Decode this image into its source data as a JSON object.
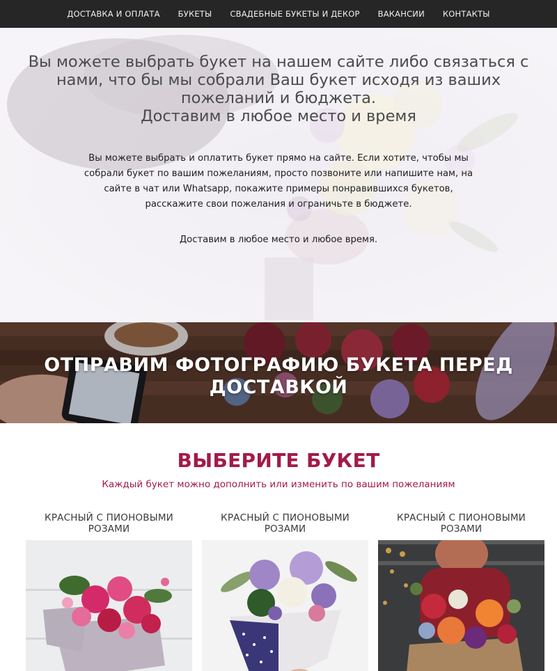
{
  "nav": {
    "items": [
      {
        "label": "ДОСТАВКА И ОПЛАТА"
      },
      {
        "label": "БУКЕТЫ"
      },
      {
        "label": "СВАДЕБНЫЕ БУКЕТЫ И ДЕКОР"
      },
      {
        "label": "ВАКАНСИИ"
      },
      {
        "label": "КОНТАКТЫ"
      }
    ]
  },
  "hero": {
    "heading_lines": [
      "Вы можете выбрать букет на нашем сайте либо связаться с",
      "нами, что бы мы собрали Ваш букет исходя из ваших",
      "пожеланий и бюджета.",
      "Доставим в любое место и время"
    ],
    "text": "Вы можете выбрать и оплатить букет прямо на сайте. Если хотите, чтобы мы собрали букет по вашим пожеланиям, просто позвоните или напишите нам, на сайте в чат или Whatsapp, покажите примеры понравившихся букетов, расскажите свои пожелания и ограничьте в бюджете.",
    "text2": "Доставим в любое место и любое время."
  },
  "banner": {
    "title_lines": [
      "ОТПРАВИМ ФОТОГРАФИЮ БУКЕТА ПЕРЕД",
      "ДОСТАВКОЙ"
    ]
  },
  "catalog": {
    "title": "ВЫБЕРИТЕ БУКЕТ",
    "subtitle": "Каждый букет можно дополнить или изменить по вашим пожеланиям",
    "products": [
      {
        "name_lines": [
          "КРАСНЫЙ С ПИОНОВЫМИ",
          "РОЗАМИ"
        ]
      },
      {
        "name_lines": [
          "КРАСНЫЙ С ПИОНОВЫМИ",
          "РОЗАМИ"
        ]
      },
      {
        "name_lines": [
          "КРАСНЫЙ С ПИОНОВЫМИ",
          "РОЗАМИ"
        ]
      }
    ]
  },
  "colors": {
    "nav_bg": "#262626",
    "accent": "#a31a4a"
  }
}
